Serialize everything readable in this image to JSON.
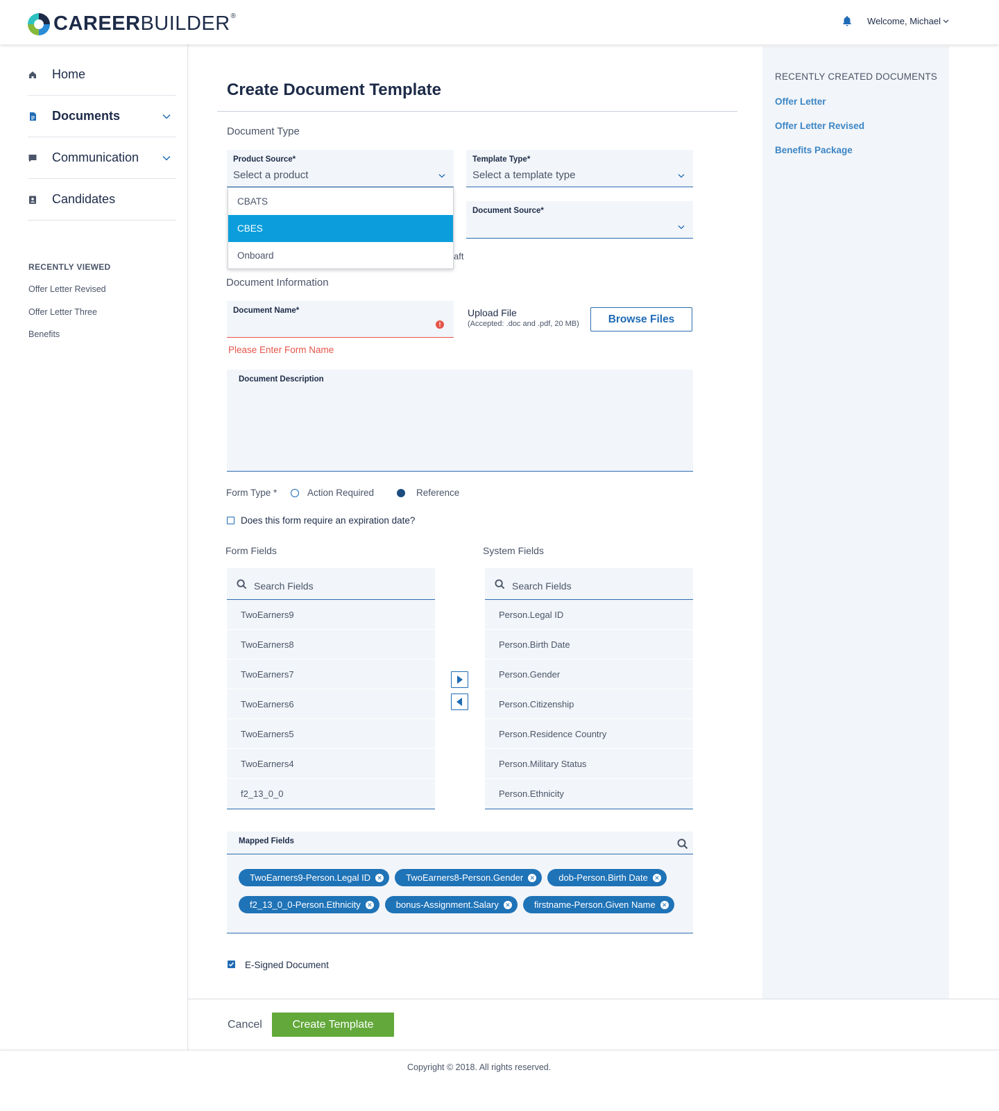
{
  "header": {
    "logo_bold": "CAREER",
    "logo_light": "BUILDER",
    "logo_reg": "®",
    "welcome": "Welcome, Michael"
  },
  "sidebar": {
    "nav": [
      {
        "label": "Home",
        "icon": "home-icon"
      },
      {
        "label": "Documents",
        "icon": "document-icon",
        "active": true,
        "expandable": true
      },
      {
        "label": "Communication",
        "icon": "chat-icon",
        "expandable": true
      },
      {
        "label": "Candidates",
        "icon": "badge-icon"
      }
    ],
    "recently_viewed_title": "RECENTLY VIEWED",
    "recently_viewed": [
      "Offer Letter Revised",
      "Offer Letter Three",
      "Benefits"
    ]
  },
  "main": {
    "title": "Create Document Template",
    "document_type_section": "Document Type",
    "product_source": {
      "label": "Product Source*",
      "placeholder": "Select a product",
      "options": [
        "CBATS",
        "CBES",
        "Onboard"
      ],
      "selected": "CBES"
    },
    "template_type": {
      "label": "Template Type*",
      "placeholder": "Select a template type"
    },
    "document_source": {
      "label": "Document Source*",
      "value": ""
    },
    "hidden_text_fragment": "aft",
    "document_information_section": "Document Information",
    "document_name": {
      "label": "Document Name*",
      "value": "",
      "error": "Please Enter Form Name"
    },
    "upload": {
      "label": "Upload File",
      "hint": "(Accepted: .doc and .pdf, 20 MB)",
      "button": "Browse Files"
    },
    "description": {
      "label": "Document Description",
      "value": ""
    },
    "form_type": {
      "label": "Form Type *",
      "options": [
        "Action Required",
        "Reference"
      ],
      "selected": "Reference"
    },
    "expiration_checkbox": {
      "label": "Does this form require an expiration date?",
      "checked": false
    },
    "form_fields": {
      "title": "Form Fields",
      "search_placeholder": "Search Fields",
      "items": [
        "TwoEarners9",
        "TwoEarners8",
        "TwoEarners7",
        "TwoEarners6",
        "TwoEarners5",
        "TwoEarners4",
        "f2_13_0_0"
      ]
    },
    "system_fields": {
      "title": "System Fields",
      "search_placeholder": "Search Fields",
      "items": [
        "Person.Legal ID",
        "Person.Birth Date",
        "Person.Gender",
        "Person.Citizenship",
        "Person.Residence Country",
        "Person.Military Status",
        "Person.Ethnicity"
      ]
    },
    "mapped_fields": {
      "title": "Mapped Fields",
      "rows": [
        [
          "TwoEarners9-Person.Legal ID",
          "TwoEarners8-Person.Gender",
          "dob-Person.Birth Date"
        ],
        [
          "f2_13_0_0-Person.Ethnicity",
          "bonus-Assignment.Salary",
          "firstname-Person.Given Name"
        ]
      ]
    },
    "esigned": {
      "label": "E-Signed Document",
      "checked": true
    },
    "cancel": "Cancel",
    "create": "Create Template"
  },
  "right_panel": {
    "title": "RECENTLY CREATED DOCUMENTS",
    "links": [
      "Offer Letter",
      "Offer Letter Revised",
      "Benefits Package"
    ]
  },
  "footer": {
    "copyright": "Copyright © 2018. All rights reserved."
  },
  "colors": {
    "primary": "#1f6bb5",
    "dropdown_selected": "#0c9edc",
    "error": "#e5554a",
    "create_button": "#62a83a",
    "chip": "#1f73b7",
    "panel_bg": "#f2f5f9"
  }
}
